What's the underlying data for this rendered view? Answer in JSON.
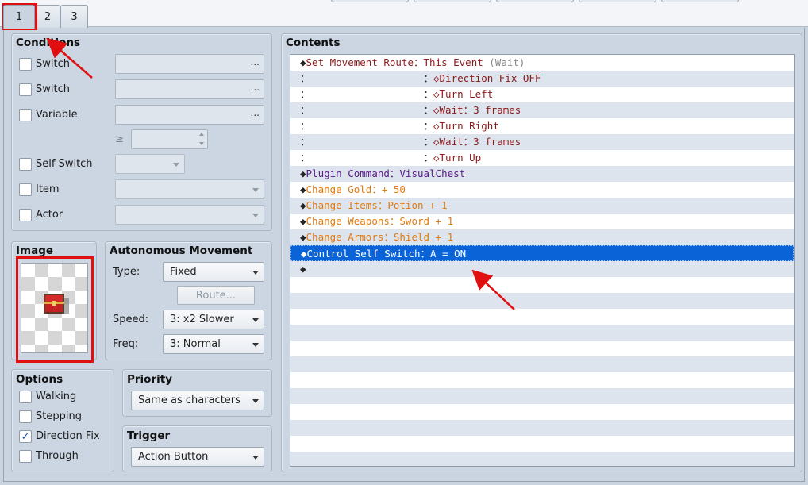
{
  "tabs": [
    "1",
    "2",
    "3"
  ],
  "conditions": {
    "title": "Conditions",
    "switch1_label": "Switch",
    "switch2_label": "Switch",
    "variable_label": "Variable",
    "ge_symbol": "≥",
    "self_switch_label": "Self Switch",
    "item_label": "Item",
    "actor_label": "Actor",
    "ellipsis": "..."
  },
  "image": {
    "title": "Image",
    "graphic": "treasure-chest"
  },
  "autonomous": {
    "title": "Autonomous Movement",
    "type_label": "Type:",
    "type_value": "Fixed",
    "route_button": "Route...",
    "speed_label": "Speed:",
    "speed_value": "3: x2 Slower",
    "freq_label": "Freq:",
    "freq_value": "3: Normal"
  },
  "options": {
    "title": "Options",
    "items": [
      {
        "label": "Walking",
        "checked": false
      },
      {
        "label": "Stepping",
        "checked": false
      },
      {
        "label": "Direction Fix",
        "checked": true
      },
      {
        "label": "Through",
        "checked": false
      }
    ],
    "check_glyph": "✓"
  },
  "priority": {
    "title": "Priority",
    "value": "Same as characters"
  },
  "trigger": {
    "title": "Trigger",
    "value": "Action Button"
  },
  "contents": {
    "title": "Contents",
    "rows": [
      {
        "segments": [
          [
            "◆",
            "c-black"
          ],
          [
            "Set Movement Route：This Event ",
            "c-brown"
          ],
          [
            "(Wait)",
            "c-gray"
          ]
        ]
      },
      {
        "segments": [
          [
            "：                   ：",
            "c-black"
          ],
          [
            "◇Direction Fix OFF",
            "c-brown"
          ]
        ]
      },
      {
        "segments": [
          [
            "：                   ：",
            "c-black"
          ],
          [
            "◇Turn Left",
            "c-brown"
          ]
        ]
      },
      {
        "segments": [
          [
            "：                   ：",
            "c-black"
          ],
          [
            "◇Wait：3 frames",
            "c-brown"
          ]
        ]
      },
      {
        "segments": [
          [
            "：                   ：",
            "c-black"
          ],
          [
            "◇Turn Right",
            "c-brown"
          ]
        ]
      },
      {
        "segments": [
          [
            "：                   ：",
            "c-black"
          ],
          [
            "◇Wait：3 frames",
            "c-brown"
          ]
        ]
      },
      {
        "segments": [
          [
            "：                   ：",
            "c-black"
          ],
          [
            "◇Turn Up",
            "c-brown"
          ]
        ]
      },
      {
        "segments": [
          [
            "◆",
            "c-black"
          ],
          [
            "Plugin Command：",
            "c-purple"
          ],
          [
            "VisualChest",
            "c-purple"
          ]
        ]
      },
      {
        "segments": [
          [
            "◆",
            "c-black"
          ],
          [
            "Change Gold：+ 50",
            "c-orange"
          ]
        ]
      },
      {
        "segments": [
          [
            "◆",
            "c-black"
          ],
          [
            "Change Items：Potion + 1",
            "c-orange"
          ]
        ]
      },
      {
        "segments": [
          [
            "◆",
            "c-black"
          ],
          [
            "Change Weapons：Sword + 1",
            "c-orange"
          ]
        ]
      },
      {
        "segments": [
          [
            "◆",
            "c-black"
          ],
          [
            "Change Armors：Shield + 1",
            "c-orange"
          ]
        ]
      },
      {
        "segments": [
          [
            "◆",
            "c-black"
          ],
          [
            "Control Self Switch：A = ON",
            "c-black"
          ]
        ],
        "selected": true
      },
      {
        "segments": [
          [
            "◆",
            "c-black"
          ]
        ]
      }
    ]
  },
  "colors": {
    "selection": "#0a64d8",
    "annotation": "#e01010"
  }
}
